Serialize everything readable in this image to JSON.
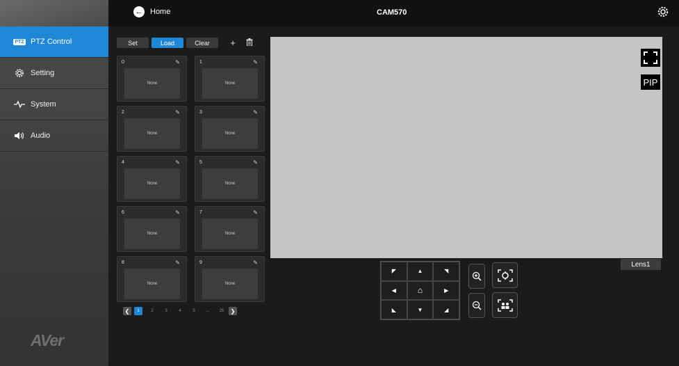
{
  "header": {
    "home_label": "Home",
    "camera_name": "CAM570"
  },
  "sidebar": {
    "items": [
      {
        "label": "PTZ Control",
        "badge": "PTZ",
        "icon": "ptz-icon",
        "active": true
      },
      {
        "label": "Setting",
        "icon": "gear-icon"
      },
      {
        "label": "System",
        "icon": "pulse-icon"
      },
      {
        "label": "Audio",
        "icon": "speaker-icon"
      }
    ],
    "logo": "AVer"
  },
  "preset_toolbar": {
    "set": "Set",
    "load": "Load",
    "clear": "Clear",
    "add_icon": "+",
    "delete_icon": "🗑",
    "active": "Load"
  },
  "presets": [
    {
      "num": "0",
      "thumb": "None"
    },
    {
      "num": "1",
      "thumb": "None"
    },
    {
      "num": "2",
      "thumb": "None"
    },
    {
      "num": "3",
      "thumb": "None"
    },
    {
      "num": "4",
      "thumb": "None"
    },
    {
      "num": "5",
      "thumb": "None"
    },
    {
      "num": "6",
      "thumb": "None"
    },
    {
      "num": "7",
      "thumb": "None"
    },
    {
      "num": "8",
      "thumb": "None"
    },
    {
      "num": "9",
      "thumb": "None"
    }
  ],
  "pagination": {
    "pages": [
      "1",
      "2",
      "3",
      "4",
      "5",
      "...",
      "25"
    ],
    "current": "1"
  },
  "preview": {
    "pip_label": "PIP",
    "lens_label": "Lens1"
  },
  "colors": {
    "accent": "#1f87d6",
    "preview_bg": "#c5c5c5"
  }
}
